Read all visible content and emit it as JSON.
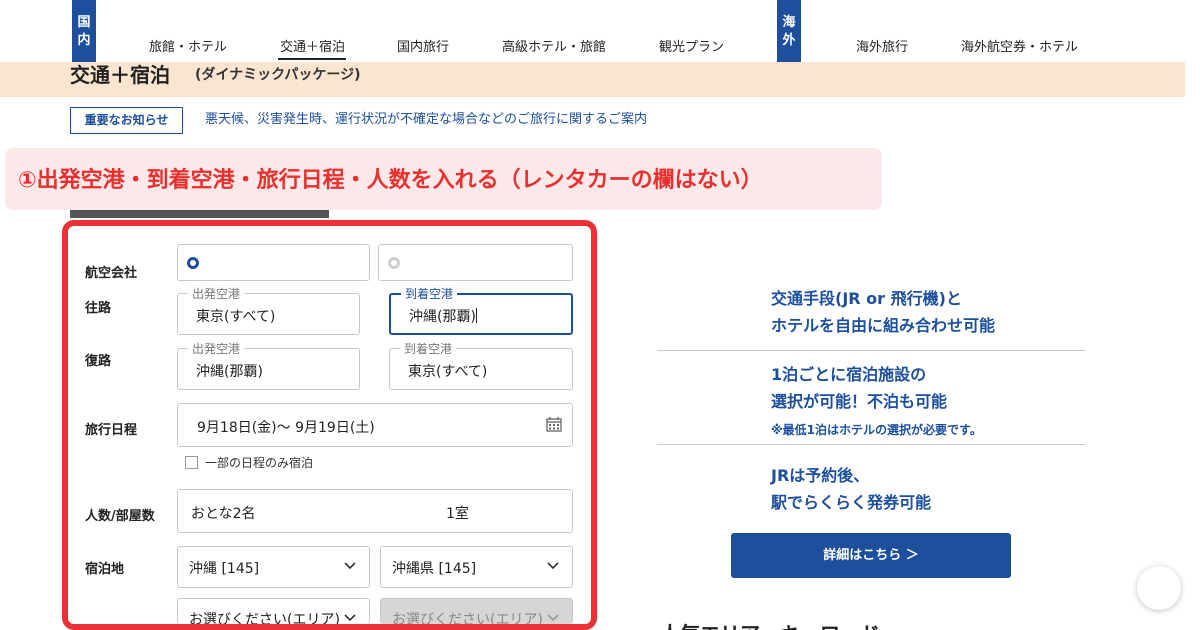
{
  "nav": {
    "domestic_badge": [
      "国",
      "内"
    ],
    "overseas_badge": [
      "海",
      "外"
    ],
    "items": [
      "旅館・ホテル",
      "交通＋宿泊",
      "国内旅行",
      "高級ホテル・旅館",
      "観光プラン",
      "海外旅行",
      "海外航空券・ホテル"
    ],
    "active_item": "交通＋宿泊"
  },
  "header": {
    "title": "交通＋宿泊",
    "subtitle": "(ダイナミックパッケージ)"
  },
  "notice": {
    "button_label": "重要なお知らせ",
    "text": "悪天候、災害発生時、運行状況が不確定な場合などのご旅行に関するご案内"
  },
  "annotation": {
    "text": "①出発空港・到着空港・旅行日程・人数を入れる（レンタカーの欄はない）"
  },
  "form": {
    "airline_label": "航空会社",
    "outbound_label": "往路",
    "return_label": "復路",
    "departure_airport_label": "出発空港",
    "arrival_airport_label": "到着空港",
    "outbound_departure_value": "東京(すべて)",
    "outbound_arrival_value": "沖縄(那覇)",
    "return_departure_value": "沖縄(那覇)",
    "return_arrival_value": "東京(すべて)",
    "schedule_label": "旅行日程",
    "schedule_value": "9月18日(金)〜 9月19日(土)",
    "partial_stay_label": "一部の日程のみ宿泊",
    "guests_label": "人数/部屋数",
    "guests_value": "おとな2名",
    "rooms_value": "1室",
    "stay_label": "宿泊地",
    "stay_region_value": "沖縄 [145]",
    "stay_prefecture_value": "沖縄県 [145]",
    "area_placeholder": "お選びください(エリア)",
    "area_placeholder_disabled": "お選びください(エリア)"
  },
  "promo": {
    "heading1_line1": "交通手段(JR or 飛行機)と",
    "heading1_line2": "ホテルを自由に組み合わせ可能",
    "heading2_line1": "1泊ごとに宿泊施設の",
    "heading2_line2": "選択が可能！不泊も可能",
    "note2": "※最低1泊はホテルの選択が必要です。",
    "heading3_line1": "JRは予約後、",
    "heading3_line2": "駅でらくらく発券可能",
    "detail_button": "詳細はこちら ＞",
    "cut_heading": "人気エリア・キーワード"
  },
  "colors": {
    "brand_blue": "#1d4f9c",
    "annotation_red": "#e8302f",
    "header_peach": "#fbe5d0"
  }
}
